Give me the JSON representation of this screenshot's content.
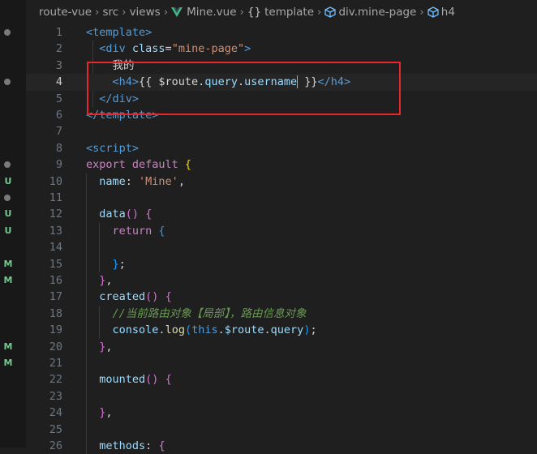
{
  "breadcrumb": {
    "items": [
      "route-vue",
      "src",
      "views",
      "Mine.vue",
      "template",
      "div.mine-page",
      "h4"
    ]
  },
  "gutter": {
    "badges": [
      {
        "line": 10,
        "text": "U",
        "color": "#73c991"
      },
      {
        "line": 12,
        "text": "U",
        "color": "#73c991"
      },
      {
        "line": 13,
        "text": "U",
        "color": "#73c991"
      },
      {
        "line": 15,
        "text": "M",
        "color": "#73c991"
      },
      {
        "line": 16,
        "text": "M",
        "color": "#73c991"
      },
      {
        "line": 20,
        "text": "M",
        "color": "#73c991"
      },
      {
        "line": 21,
        "text": "M",
        "color": "#73c991"
      }
    ],
    "dots": [
      {
        "line": 1,
        "color": "#7a7a7a"
      },
      {
        "line": 4,
        "color": "#7a7a7a"
      },
      {
        "line": 9,
        "color": "#7a7a7a"
      },
      {
        "line": 11,
        "color": "#7a7a7a"
      }
    ]
  },
  "editor": {
    "current_line": 4,
    "lines": [
      {
        "n": 1,
        "tokens": [
          [
            "t-tag",
            "<template>"
          ]
        ]
      },
      {
        "n": 2,
        "tokens": [
          [
            "t-punc",
            "  "
          ],
          [
            "t-tag",
            "<div "
          ],
          [
            "t-attr",
            "class"
          ],
          [
            "t-punc",
            "="
          ],
          [
            "t-str",
            "\"mine-page\""
          ],
          [
            "t-tag",
            ">"
          ]
        ]
      },
      {
        "n": 3,
        "tokens": [
          [
            "t-punc",
            "    我的"
          ]
        ]
      },
      {
        "n": 4,
        "tokens": [
          [
            "t-punc",
            "    "
          ],
          [
            "t-tag",
            "<h4>"
          ],
          [
            "t-punc",
            "{{ $route."
          ],
          [
            "t-var",
            "query"
          ],
          [
            "t-punc",
            "."
          ],
          [
            "t-var",
            "username"
          ],
          [
            "cursor",
            ""
          ],
          [
            "t-punc",
            " }}"
          ],
          [
            "t-tag",
            "</h4>"
          ]
        ]
      },
      {
        "n": 5,
        "tokens": [
          [
            "t-punc",
            "  "
          ],
          [
            "t-tag",
            "</div>"
          ]
        ]
      },
      {
        "n": 6,
        "tokens": [
          [
            "t-tag",
            "</template>"
          ]
        ]
      },
      {
        "n": 7,
        "tokens": []
      },
      {
        "n": 8,
        "tokens": [
          [
            "t-tag",
            "<script>"
          ]
        ]
      },
      {
        "n": 9,
        "tokens": [
          [
            "t-kw",
            "export default "
          ],
          [
            "t-brace-y",
            "{"
          ]
        ]
      },
      {
        "n": 10,
        "tokens": [
          [
            "t-punc",
            "  "
          ],
          [
            "t-var",
            "name"
          ],
          [
            "t-punc",
            ": "
          ],
          [
            "t-str",
            "'Mine'"
          ],
          [
            "t-punc",
            ","
          ]
        ]
      },
      {
        "n": 11,
        "tokens": []
      },
      {
        "n": 12,
        "tokens": [
          [
            "t-punc",
            "  "
          ],
          [
            "t-var",
            "data"
          ],
          [
            "t-pink",
            "()"
          ],
          [
            "t-punc",
            " "
          ],
          [
            "t-pink",
            "{"
          ]
        ]
      },
      {
        "n": 13,
        "tokens": [
          [
            "t-punc",
            "    "
          ],
          [
            "t-kw",
            "return "
          ],
          [
            "t-blue",
            "{"
          ]
        ]
      },
      {
        "n": 14,
        "tokens": []
      },
      {
        "n": 15,
        "tokens": [
          [
            "t-punc",
            "    "
          ],
          [
            "t-blue",
            "}"
          ],
          [
            "t-punc",
            ";"
          ]
        ]
      },
      {
        "n": 16,
        "tokens": [
          [
            "t-punc",
            "  "
          ],
          [
            "t-pink",
            "}"
          ],
          [
            "t-punc",
            ","
          ]
        ]
      },
      {
        "n": 17,
        "tokens": [
          [
            "t-punc",
            "  "
          ],
          [
            "t-var",
            "created"
          ],
          [
            "t-pink",
            "()"
          ],
          [
            "t-punc",
            " "
          ],
          [
            "t-pink",
            "{"
          ]
        ]
      },
      {
        "n": 18,
        "tokens": [
          [
            "t-punc",
            "    "
          ],
          [
            "t-com",
            "//当前路由对象【局部】，路由信息对象"
          ]
        ]
      },
      {
        "n": 19,
        "tokens": [
          [
            "t-punc",
            "    "
          ],
          [
            "t-var",
            "console"
          ],
          [
            "t-punc",
            "."
          ],
          [
            "t-fn",
            "log"
          ],
          [
            "t-blue",
            "("
          ],
          [
            "t-this",
            "this"
          ],
          [
            "t-punc",
            "."
          ],
          [
            "t-var",
            "$route"
          ],
          [
            "t-punc",
            "."
          ],
          [
            "t-var",
            "query"
          ],
          [
            "t-blue",
            ")"
          ],
          [
            "t-punc",
            ";"
          ]
        ]
      },
      {
        "n": 20,
        "tokens": [
          [
            "t-punc",
            "  "
          ],
          [
            "t-pink",
            "}"
          ],
          [
            "t-punc",
            ","
          ]
        ]
      },
      {
        "n": 21,
        "tokens": []
      },
      {
        "n": 22,
        "tokens": [
          [
            "t-punc",
            "  "
          ],
          [
            "t-var",
            "mounted"
          ],
          [
            "t-pink",
            "()"
          ],
          [
            "t-punc",
            " "
          ],
          [
            "t-pink",
            "{"
          ]
        ]
      },
      {
        "n": 23,
        "tokens": []
      },
      {
        "n": 24,
        "tokens": [
          [
            "t-punc",
            "  "
          ],
          [
            "t-pink",
            "}"
          ],
          [
            "t-punc",
            ","
          ]
        ]
      },
      {
        "n": 25,
        "tokens": []
      },
      {
        "n": 26,
        "tokens": [
          [
            "t-punc",
            "  "
          ],
          [
            "t-var",
            "methods"
          ],
          [
            "t-punc",
            ": "
          ],
          [
            "t-pink",
            "{"
          ]
        ]
      }
    ]
  },
  "colors": {
    "background": "#1f1f1f",
    "highlight_box": "#e5262b"
  }
}
